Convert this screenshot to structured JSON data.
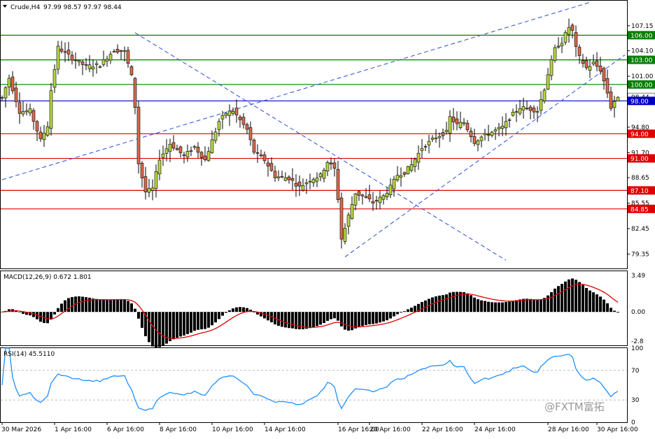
{
  "header": {
    "symbol": "Crude,H4",
    "ohlc": "97.99 98.57 97.97 98.44"
  },
  "watermark": "@FXTM富拓",
  "main_axis": {
    "ylim": [
      77.6,
      110.2
    ],
    "ticks": [
      "107.15",
      "104.10",
      "101.00",
      "94.80",
      "91.70",
      "88.65",
      "85.55",
      "82.45",
      "79.35"
    ],
    "current_price": "98.44"
  },
  "levels": [
    {
      "value": 106.0,
      "label": "106.00",
      "color": "#008000"
    },
    {
      "value": 103.0,
      "label": "103.00",
      "color": "#008000"
    },
    {
      "value": 100.0,
      "label": "100.00",
      "color": "#008000"
    },
    {
      "value": 98.0,
      "label": "98.00",
      "color": "#0000c0"
    },
    {
      "value": 94.0,
      "label": "94.00",
      "color": "#e00000"
    },
    {
      "value": 91.0,
      "label": "91.00",
      "color": "#e00000"
    },
    {
      "value": 87.1,
      "label": "87.10",
      "color": "#e00000"
    },
    {
      "value": 84.85,
      "label": "84.85",
      "color": "#e00000"
    }
  ],
  "dates": [
    "30 Mar 2026",
    "1 Apr 16:00",
    "6 Apr 16:00",
    "8 Apr 16:00",
    "10 Apr 16:00",
    "14 Apr 16:00",
    "16 Apr 16:00",
    "20 Apr 16:00",
    "22 Apr 16:00",
    "24 Apr 16:00",
    "28 Apr 16:00",
    "30 Apr 16:00"
  ],
  "macd": {
    "label": "MACD(12,26,9) 0.672 1.801",
    "ticks": [
      "3.49",
      "0.00",
      "-2.8"
    ],
    "ylim": [
      -3.2,
      3.9
    ]
  },
  "rsi": {
    "label": "RSI(14) 45.5110",
    "ticks": [
      "100",
      "70",
      "30",
      "0"
    ],
    "ylim": [
      0,
      100
    ]
  },
  "chart_data": {
    "type": "candlestick",
    "series_anchors": [
      {
        "i": 0,
        "close": 98.4
      },
      {
        "i": 2,
        "close": 100.8
      },
      {
        "i": 5,
        "close": 96.7
      },
      {
        "i": 8,
        "close": 96.8
      },
      {
        "i": 11,
        "close": 93.2
      },
      {
        "i": 13,
        "close": 95.0
      },
      {
        "i": 14,
        "close": 99.3
      },
      {
        "i": 16,
        "close": 104.5
      },
      {
        "i": 20,
        "close": 103.2
      },
      {
        "i": 24,
        "close": 102.2
      },
      {
        "i": 28,
        "close": 102.4
      },
      {
        "i": 32,
        "close": 104.2
      },
      {
        "i": 35,
        "close": 104.0
      },
      {
        "i": 37,
        "close": 101.0
      },
      {
        "i": 38,
        "close": 97.3
      },
      {
        "i": 39,
        "close": 90.4
      },
      {
        "i": 41,
        "close": 86.9
      },
      {
        "i": 43,
        "close": 87.3
      },
      {
        "i": 45,
        "close": 91.0
      },
      {
        "i": 48,
        "close": 92.8
      },
      {
        "i": 52,
        "close": 91.3
      },
      {
        "i": 55,
        "close": 92.4
      },
      {
        "i": 58,
        "close": 90.8
      },
      {
        "i": 62,
        "close": 95.5
      },
      {
        "i": 64,
        "close": 96.5
      },
      {
        "i": 66,
        "close": 96.8
      },
      {
        "i": 70,
        "close": 94.5
      },
      {
        "i": 72,
        "close": 91.8
      },
      {
        "i": 75,
        "close": 90.8
      },
      {
        "i": 78,
        "close": 88.8
      },
      {
        "i": 82,
        "close": 88.6
      },
      {
        "i": 85,
        "close": 87.5
      },
      {
        "i": 88,
        "close": 88.4
      },
      {
        "i": 91,
        "close": 88.9
      },
      {
        "i": 93,
        "close": 90.6
      },
      {
        "i": 95,
        "close": 89.7
      },
      {
        "i": 96,
        "close": 86.1
      },
      {
        "i": 97,
        "close": 81.2
      },
      {
        "i": 98,
        "close": 82.5
      },
      {
        "i": 99,
        "close": 84.0
      },
      {
        "i": 101,
        "close": 86.8
      },
      {
        "i": 104,
        "close": 86.2
      },
      {
        "i": 106,
        "close": 85.6
      },
      {
        "i": 109,
        "close": 86.4
      },
      {
        "i": 111,
        "close": 87.5
      },
      {
        "i": 113,
        "close": 89.0
      },
      {
        "i": 115,
        "close": 89.3
      },
      {
        "i": 117,
        "close": 90.2
      },
      {
        "i": 120,
        "close": 92.3
      },
      {
        "i": 124,
        "close": 93.6
      },
      {
        "i": 127,
        "close": 94.2
      },
      {
        "i": 128,
        "close": 96.0
      },
      {
        "i": 130,
        "close": 95.1
      },
      {
        "i": 132,
        "close": 95.4
      },
      {
        "i": 135,
        "close": 93.0
      },
      {
        "i": 137,
        "close": 93.6
      },
      {
        "i": 140,
        "close": 94.2
      },
      {
        "i": 143,
        "close": 94.8
      },
      {
        "i": 146,
        "close": 96.4
      },
      {
        "i": 148,
        "close": 97.2
      },
      {
        "i": 151,
        "close": 97.0
      },
      {
        "i": 153,
        "close": 96.8
      },
      {
        "i": 155,
        "close": 99.5
      },
      {
        "i": 156,
        "close": 101.3
      },
      {
        "i": 158,
        "close": 104.3
      },
      {
        "i": 160,
        "close": 105.2
      },
      {
        "i": 162,
        "close": 107.0
      },
      {
        "i": 163,
        "close": 106.5
      },
      {
        "i": 164,
        "close": 104.4
      },
      {
        "i": 165,
        "close": 103.3
      },
      {
        "i": 167,
        "close": 102.0
      },
      {
        "i": 169,
        "close": 102.6
      },
      {
        "i": 171,
        "close": 101.8
      },
      {
        "i": 173,
        "close": 99.0
      },
      {
        "i": 174,
        "close": 97.2
      },
      {
        "i": 175,
        "close": 97.99
      },
      {
        "i": 176,
        "close": 98.44
      }
    ],
    "ohlc_last": {
      "open": 97.99,
      "high": 98.57,
      "low": 97.97,
      "close": 98.44
    },
    "trendlines": [
      {
        "from": {
          "i": 0,
          "price": 88.4
        },
        "to": {
          "i": 168,
          "price": 110.0
        }
      },
      {
        "from": {
          "i": 38,
          "price": 106.3
        },
        "to": {
          "i": 144,
          "price": 78.6
        }
      },
      {
        "from": {
          "i": 98,
          "price": 79.0
        },
        "to": {
          "i": 178,
          "price": 103.6
        }
      }
    ]
  }
}
